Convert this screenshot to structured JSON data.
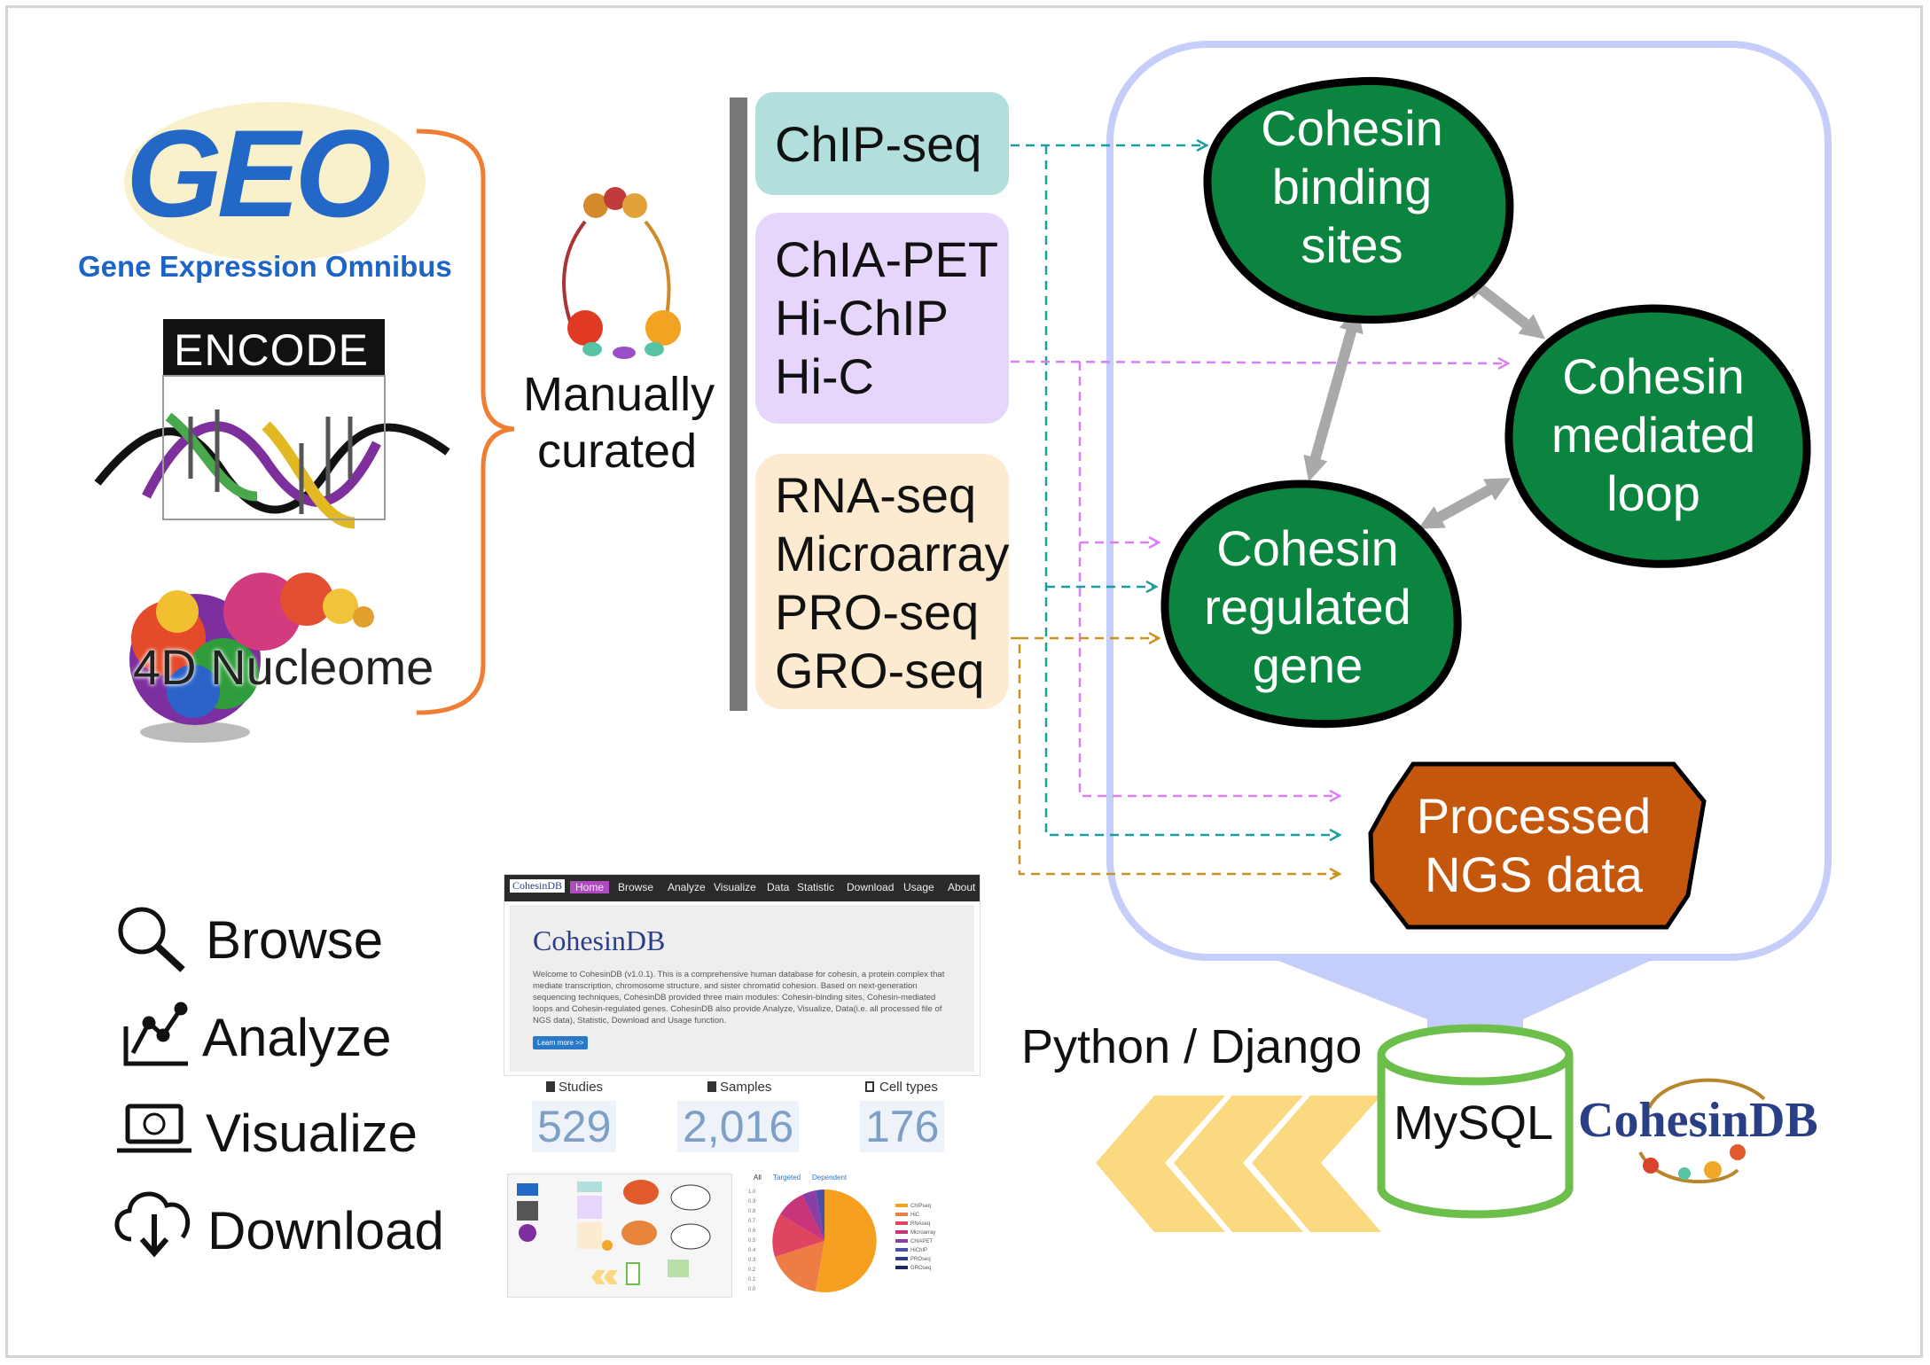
{
  "sources": {
    "geo_logo": "GEO",
    "geo_tagline": "Gene Expression Omnibus",
    "encode_logo": "ENCODE",
    "nucleome_logo": "4D Nucleome"
  },
  "curation": {
    "label_line1": "Manually",
    "label_line2": "curated"
  },
  "data_types": {
    "chip": [
      "ChIP-seq"
    ],
    "interaction": [
      "ChIA-PET",
      "Hi-ChIP",
      "Hi-C"
    ],
    "expression": [
      "RNA-seq",
      "Microarray",
      "PRO-seq",
      "GRO-seq"
    ]
  },
  "modules": {
    "binding": [
      "Cohesin",
      "binding",
      "sites"
    ],
    "loop": [
      "Cohesin",
      "mediated",
      "loop"
    ],
    "gene": [
      "Cohesin",
      "regulated",
      "gene"
    ],
    "ngs": [
      "Processed",
      "NGS data"
    ]
  },
  "database": {
    "backend_label": "Python / Django",
    "db_label": "MySQL",
    "brand": "CohesinDB"
  },
  "functions": [
    "Browse",
    "Analyze",
    "Visualize",
    "Download"
  ],
  "website": {
    "nav_brand": "CohesinDB",
    "nav_items": [
      "Home",
      "Browse",
      "Analyze",
      "Visualize",
      "Data",
      "Statistic",
      "Download",
      "Usage",
      "About"
    ],
    "hero_title": "CohesinDB",
    "hero_text": "Welcome to CohesinDB (v1.0.1). This is a comprehensive human database for cohesin, a protein complex that mediate transcription, chromosome structure, and sister chromatid cohesion. Based on next-generation sequencing techniques, CohesinDB provided three main modules: Cohesin-binding sites, Cohesin-mediated loops and Cohesin-regulated genes. CohesinDB also provide Analyze, Visualize, Data(i.e. all processed file of NGS data), Statistic, Download and Usage function.",
    "learn_more": "Learn more >>",
    "stats": [
      {
        "label": "Studies",
        "value": "529"
      },
      {
        "label": "Samples",
        "value": "2,016"
      },
      {
        "label": "Cell types",
        "value": "176"
      }
    ],
    "pie_tabs": [
      "All",
      "Targeted",
      "Dependent"
    ],
    "pie_legend": [
      "ChIPseq",
      "HiC",
      "RNAseq",
      "Microarray",
      "ChIAPET",
      "HiChIP",
      "PROseq",
      "GROseq"
    ],
    "pie_axis": [
      "1.0",
      "0.9",
      "0.8",
      "0.7",
      "0.6",
      "0.5",
      "0.4",
      "0.3",
      "0.2",
      "0.1",
      "0.0"
    ]
  },
  "colors": {
    "chip_box": "#b2dfdc",
    "interaction_box": "#e6d6fb",
    "expression_box": "#fcebd0",
    "module_green": "#0b8440",
    "ngs_orange": "#c4570b",
    "db_green": "#6cbf4a",
    "bracket_orange": "#ef7d32",
    "arrow_teal": "#1b9ea0",
    "arrow_violet": "#d97ff5",
    "arrow_gold": "#c99520",
    "chevron_yellow": "#fbd980",
    "panel_outline": "#c5cdfa"
  }
}
